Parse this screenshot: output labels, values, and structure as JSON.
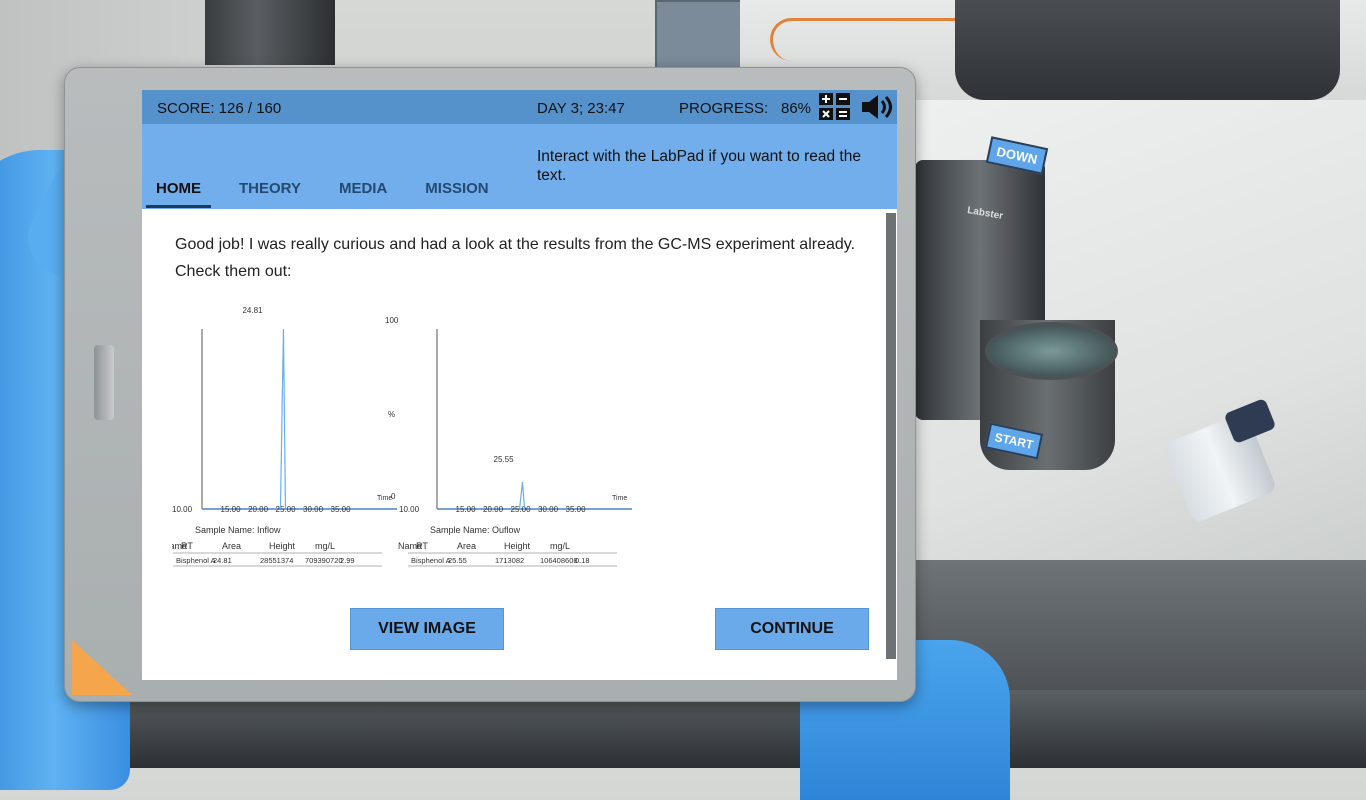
{
  "scene": {
    "buttons3d": {
      "down": "DOWN",
      "start": "START"
    },
    "equipment_brand": "Labster"
  },
  "status": {
    "score": "SCORE: 126 / 160",
    "day": "DAY 3; 23:47",
    "progress_label": "PROGRESS:",
    "progress_value": "86%",
    "progress_fraction": 0.86,
    "icons": [
      "calculator-icon",
      "speaker-icon"
    ]
  },
  "nav": {
    "tabs": [
      {
        "label": "HOME",
        "active": true
      },
      {
        "label": "THEORY",
        "active": false
      },
      {
        "label": "MEDIA",
        "active": false
      },
      {
        "label": "MISSION",
        "active": false
      }
    ],
    "hint": "Interact with the LabPad if you want to read the text."
  },
  "message": "Good job! I was really curious and had a look at the results from the GC-MS experiment already. Check them out:",
  "chart_data": [
    {
      "type": "line",
      "title": "",
      "xlabel": "Time",
      "ylabel": "",
      "x_ticks": [
        "15.00",
        "20.00",
        "25.00",
        "30.00",
        "35.00"
      ],
      "x_axis_start_label": "10.00",
      "xlim": [
        10,
        40
      ],
      "ylim": [
        0,
        100
      ],
      "peak": {
        "x": 24.81,
        "y": 100,
        "label": "24.81"
      },
      "sample_name": "Sample Name: Inflow",
      "table": {
        "columns": [
          "Name",
          "RT",
          "Area",
          "Height",
          "mg/L"
        ],
        "rows": [
          [
            "Bisphenol A",
            "24.81",
            "28551374",
            "709390720",
            "2.99"
          ]
        ]
      }
    },
    {
      "type": "line",
      "title": "",
      "xlabel": "Time",
      "ylabel": "%",
      "y_ticks": [
        "0",
        "100"
      ],
      "x_ticks": [
        "15.00",
        "20.00",
        "25.00",
        "30.00",
        "35.00"
      ],
      "x_axis_start_label": "10.00",
      "xlim": [
        10,
        40
      ],
      "ylim": [
        0,
        100
      ],
      "peak": {
        "x": 25.55,
        "y": 15,
        "label": "25.55"
      },
      "sample_name": "Sample Name: Ouflow",
      "table": {
        "columns": [
          "Name",
          "RT",
          "Area",
          "Height",
          "mg/L"
        ],
        "rows": [
          [
            "Bisphenol A",
            "25.55",
            "1713082",
            "106408608",
            "0.18"
          ]
        ]
      }
    }
  ],
  "actions": {
    "view_image": "VIEW IMAGE",
    "continue": "CONTINUE"
  }
}
